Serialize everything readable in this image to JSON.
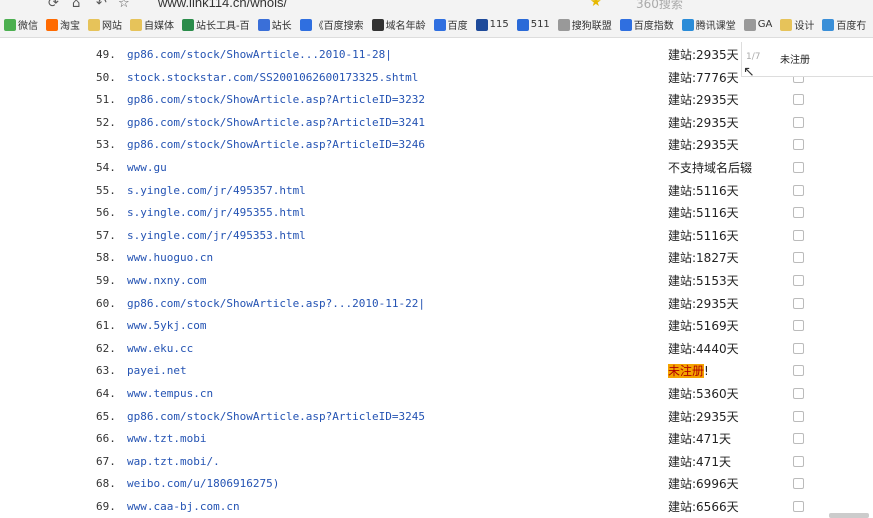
{
  "toolbar": {
    "url": "www.link114.cn/whois/",
    "search_placeholder": "360搜索"
  },
  "bookmarks": [
    {
      "label": "微信",
      "icon": "wechat-icon",
      "color": "#4caf50"
    },
    {
      "label": "淘宝",
      "icon": "taobao-icon",
      "color": "#ff6a00"
    },
    {
      "label": "网站",
      "icon": "folder-icon",
      "color": "#e6c35a"
    },
    {
      "label": "自媒体",
      "icon": "folder-icon",
      "color": "#e6c35a"
    },
    {
      "label": "站长工具-百",
      "icon": "tool-icon",
      "color": "#2a8c4a"
    },
    {
      "label": "站长",
      "icon": "chart-icon",
      "color": "#3a6fd8"
    },
    {
      "label": "《百度搜索",
      "icon": "baidu-icon",
      "color": "#2f6fe0"
    },
    {
      "label": "域名年龄",
      "icon": "domain-icon",
      "color": "#333"
    },
    {
      "label": "百度",
      "icon": "baidu-icon",
      "color": "#2f6fe0"
    },
    {
      "label": "115",
      "icon": "s-icon",
      "color": "#1e4a9a"
    },
    {
      "label": "511",
      "icon": "s-icon",
      "color": "#2a6ad8"
    },
    {
      "label": "搜狗联盟",
      "icon": "page-icon",
      "color": "#999"
    },
    {
      "label": "百度指数",
      "icon": "baidu-icon",
      "color": "#2f6fe0"
    },
    {
      "label": "腾讯课堂",
      "icon": "tencent-icon",
      "color": "#2a8cd8"
    },
    {
      "label": "GA",
      "icon": "page-icon",
      "color": "#999"
    },
    {
      "label": "设计",
      "icon": "folder-icon",
      "color": "#e6c35a"
    },
    {
      "label": "百度冇",
      "icon": "page-icon",
      "color": "#3a8fd8"
    }
  ],
  "find_bar": {
    "count": "1/7",
    "query": "未注册"
  },
  "rows": [
    {
      "num": "49.",
      "domain": "gp86.com/stock/ShowArticle...2010-11-28|",
      "status": "建站:2935天",
      "highlight": ""
    },
    {
      "num": "50.",
      "domain": "stock.stockstar.com/SS2001062600173325.shtml",
      "status": "建站:7776天",
      "highlight": ""
    },
    {
      "num": "51.",
      "domain": "gp86.com/stock/ShowArticle.asp?ArticleID=3232",
      "status": "建站:2935天",
      "highlight": ""
    },
    {
      "num": "52.",
      "domain": "gp86.com/stock/ShowArticle.asp?ArticleID=3241",
      "status": "建站:2935天",
      "highlight": ""
    },
    {
      "num": "53.",
      "domain": "gp86.com/stock/ShowArticle.asp?ArticleID=3246",
      "status": "建站:2935天",
      "highlight": ""
    },
    {
      "num": "54.",
      "domain": "www.gu",
      "status": "不支持域名后辍",
      "highlight": ""
    },
    {
      "num": "55.",
      "domain": "s.yingle.com/jr/495357.html",
      "status": "建站:5116天",
      "highlight": ""
    },
    {
      "num": "56.",
      "domain": "s.yingle.com/jr/495355.html",
      "status": "建站:5116天",
      "highlight": ""
    },
    {
      "num": "57.",
      "domain": "s.yingle.com/jr/495353.html",
      "status": "建站:5116天",
      "highlight": ""
    },
    {
      "num": "58.",
      "domain": "www.huoguo.cn",
      "status": "建站:1827天",
      "highlight": ""
    },
    {
      "num": "59.",
      "domain": "www.nxny.com",
      "status": "建站:5153天",
      "highlight": ""
    },
    {
      "num": "60.",
      "domain": "gp86.com/stock/ShowArticle.asp?...2010-11-22|",
      "status": "建站:2935天",
      "highlight": ""
    },
    {
      "num": "61.",
      "domain": "www.5ykj.com",
      "status": "建站:5169天",
      "highlight": ""
    },
    {
      "num": "62.",
      "domain": "www.eku.cc",
      "status": "建站:4440天",
      "highlight": ""
    },
    {
      "num": "63.",
      "domain": "payei.net",
      "status": "!",
      "highlight": "未注册"
    },
    {
      "num": "64.",
      "domain": "www.tempus.cn",
      "status": "建站:5360天",
      "highlight": ""
    },
    {
      "num": "65.",
      "domain": "gp86.com/stock/ShowArticle.asp?ArticleID=3245",
      "status": "建站:2935天",
      "highlight": ""
    },
    {
      "num": "66.",
      "domain": "www.tzt.mobi",
      "status": "建站:471天",
      "highlight": ""
    },
    {
      "num": "67.",
      "domain": "wap.tzt.mobi/.",
      "status": "建站:471天",
      "highlight": ""
    },
    {
      "num": "68.",
      "domain": "weibo.com/u/1806916275)",
      "status": "建站:6996天",
      "highlight": ""
    },
    {
      "num": "69.",
      "domain": "www.caa-bj.com.cn",
      "status": "建站:6566天",
      "highlight": ""
    }
  ]
}
